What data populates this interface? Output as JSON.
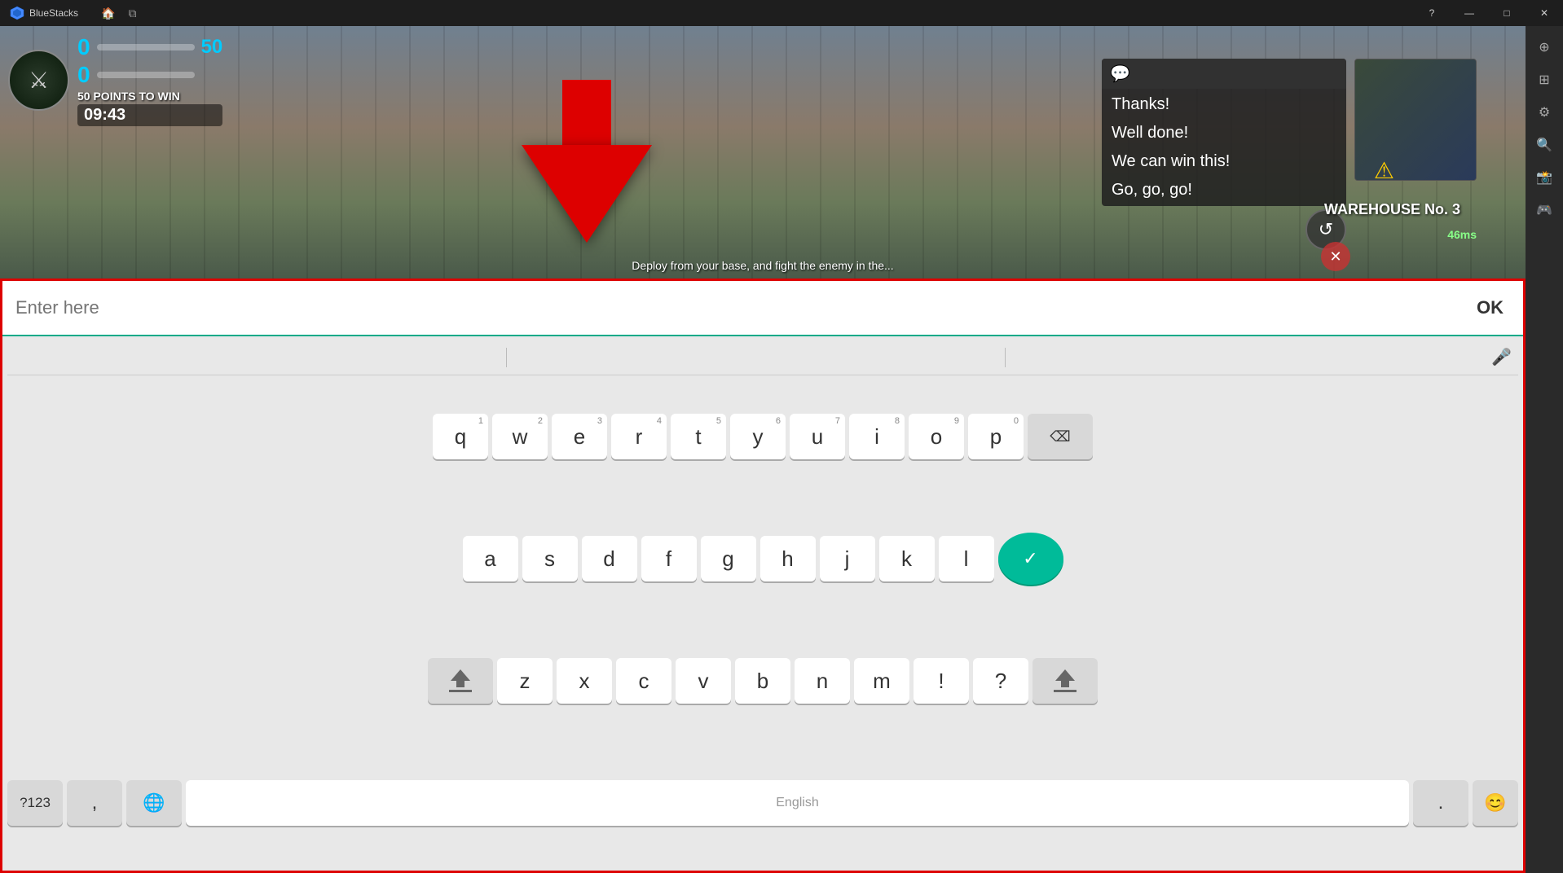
{
  "titlebar": {
    "app_name": "BlueStacks",
    "home_icon": "🏠",
    "layers_icon": "⧉"
  },
  "game": {
    "score_blue": "0",
    "score_red": "0",
    "score_target": "50",
    "points_label": "50 POINTS TO WIN",
    "timer": "09:43",
    "warehouse_label": "WAREHOUSE No. 3",
    "latency": "46ms",
    "deploy_text": "Deploy from your base, and fight the enemy in the...",
    "chat_options": [
      "Thanks!",
      "Well done!",
      "We can win this!",
      "Go, go, go!"
    ]
  },
  "keyboard": {
    "input_placeholder": "Enter here",
    "ok_label": "OK",
    "row1": [
      "q",
      "w",
      "e",
      "r",
      "t",
      "y",
      "u",
      "i",
      "o",
      "p"
    ],
    "row1_nums": [
      "1",
      "2",
      "3",
      "4",
      "5",
      "6",
      "7",
      "8",
      "9",
      "0"
    ],
    "row2": [
      "a",
      "s",
      "d",
      "f",
      "g",
      "h",
      "j",
      "k",
      "l"
    ],
    "row3": [
      "z",
      "x",
      "c",
      "v",
      "b",
      "n",
      "m",
      "!",
      "?"
    ],
    "space_label": "English",
    "num_symbol_label": "?123",
    "comma_label": ",",
    "period_label": "."
  }
}
